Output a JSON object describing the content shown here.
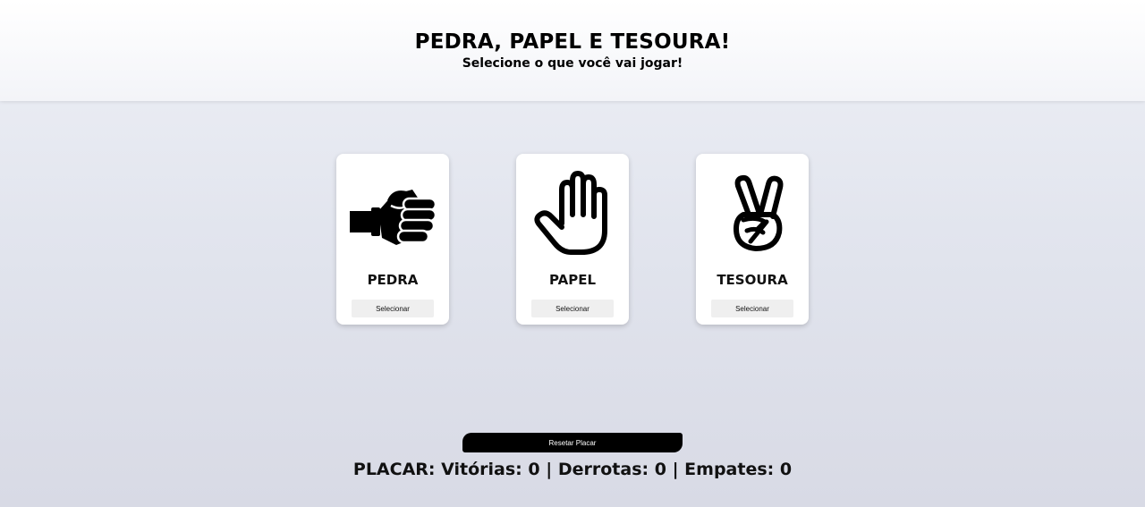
{
  "header": {
    "title": "PEDRA, PAPEL E TESOURA!",
    "subtitle": "Selecione o que você vai jogar!"
  },
  "choices": [
    {
      "label": "PEDRA",
      "icon": "fist-icon",
      "button_label": "Selecionar"
    },
    {
      "label": "PAPEL",
      "icon": "open-hand-icon",
      "button_label": "Selecionar"
    },
    {
      "label": "TESOURA",
      "icon": "peace-hand-icon",
      "button_label": "Selecionar"
    }
  ],
  "reset": {
    "label": "Resetar Placar"
  },
  "score": {
    "prefix": "PLACAR:",
    "wins_label": "Vitórias:",
    "wins": "0",
    "losses_label": "Derrotas:",
    "losses": "0",
    "ties_label": "Empates:",
    "ties": "0"
  },
  "colors": {
    "reset_button_bg": "#000000",
    "select_button_bg": "#efefef",
    "card_bg": "#ffffff"
  }
}
